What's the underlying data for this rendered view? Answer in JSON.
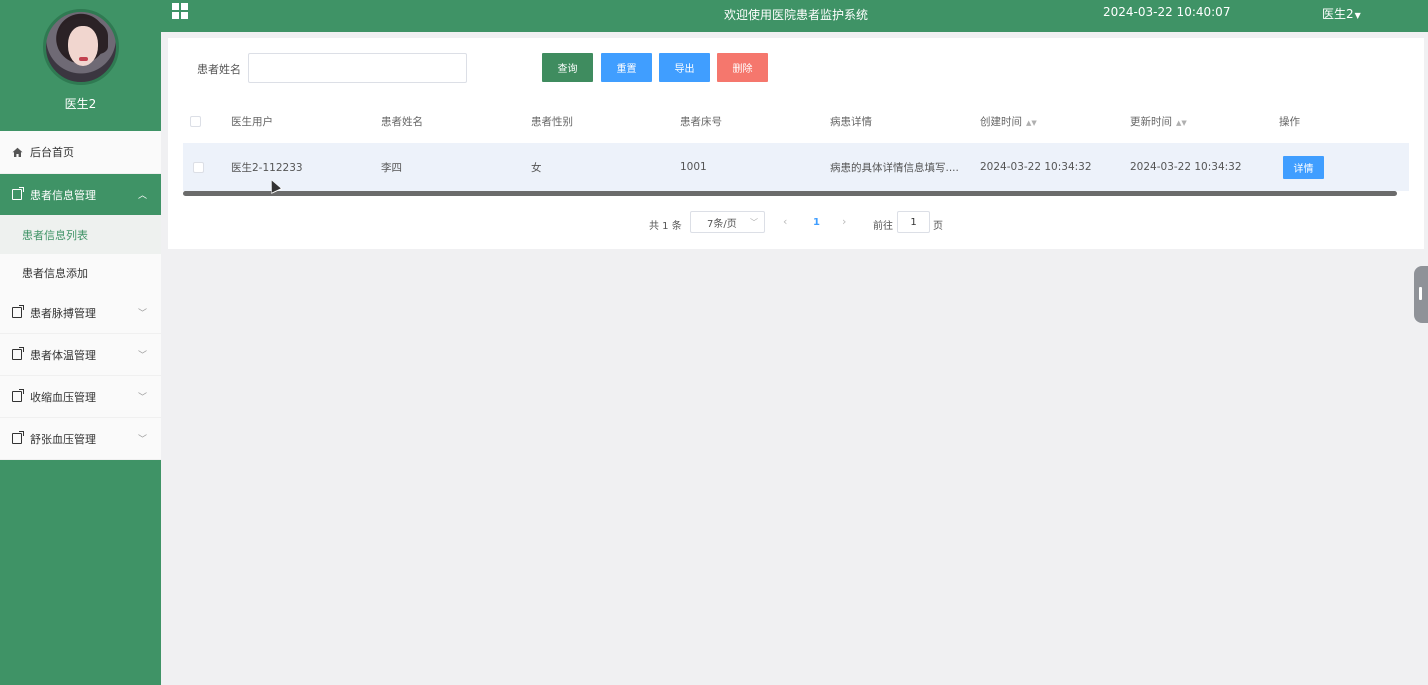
{
  "sidebar": {
    "profile_name": "医生2",
    "menu": {
      "home": "后台首页",
      "patient_info": "患者信息管理",
      "patient_info_list": "患者信息列表",
      "patient_info_add": "患者信息添加",
      "pulse": "患者脉搏管理",
      "temperature": "患者体温管理",
      "systolic": "收缩血压管理",
      "diastolic": "舒张血压管理"
    }
  },
  "header": {
    "title": "欢迎使用医院患者监护系统",
    "datetime": "2024-03-22 10:40:07",
    "user": "医生2"
  },
  "search": {
    "label": "患者姓名",
    "value": "",
    "query": "查询",
    "reset": "重置",
    "export": "导出",
    "delete": "删除"
  },
  "table": {
    "headers": {
      "doctor_user": "医生用户",
      "patient_name": "患者姓名",
      "patient_gender": "患者性别",
      "bed_no": "患者床号",
      "illness": "病患详情",
      "created": "创建时间",
      "updated": "更新时间",
      "actions": "操作"
    },
    "rows": [
      {
        "doctor_user": "医生2-112233",
        "patient_name": "李四",
        "patient_gender": "女",
        "bed_no": "1001",
        "illness": "病患的具体详情信息填写....",
        "created": "2024-03-22 10:34:32",
        "updated": "2024-03-22 10:34:32",
        "detail": "详情"
      }
    ]
  },
  "pagination": {
    "total": "共 1 条",
    "page_size": "7条/页",
    "current": "1",
    "goto": "前往",
    "goto_value": "1",
    "page_suffix": "页"
  }
}
